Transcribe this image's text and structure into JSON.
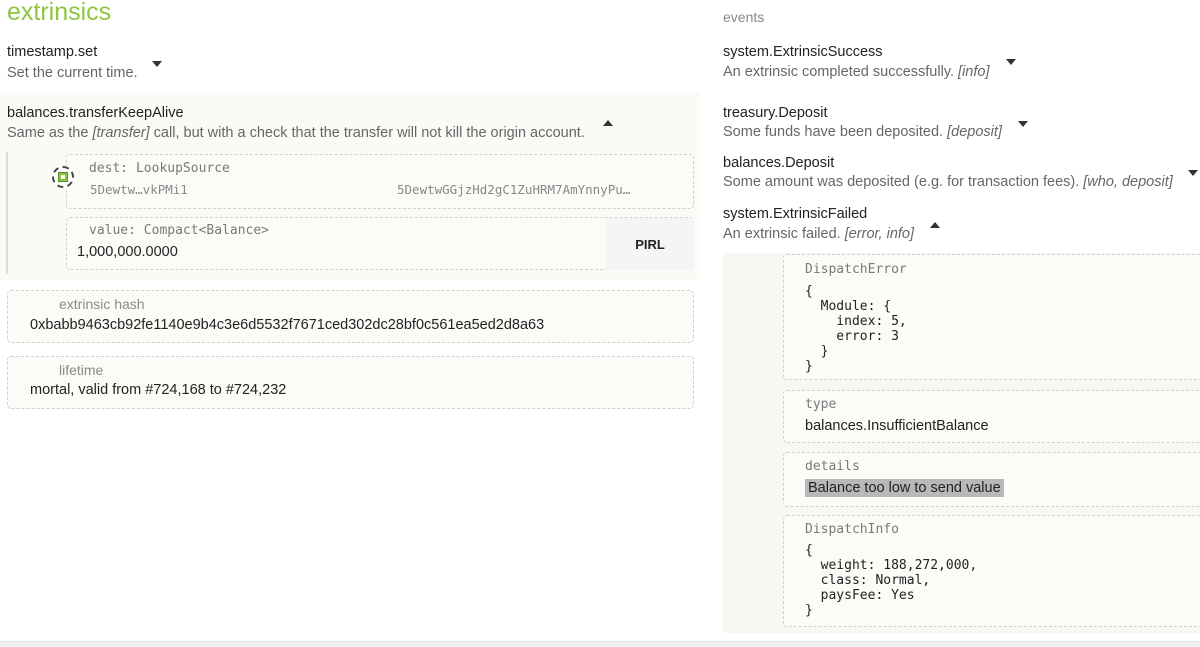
{
  "extrinsics": {
    "title": "extrinsics",
    "calls": [
      {
        "name": "timestamp.set",
        "description": "Set the current time."
      },
      {
        "name": "balances.transferKeepAlive",
        "description_prefix": "Same as the ",
        "description_arg": "[transfer]",
        "description_suffix": " call, but with a check that the transfer will not kill the origin account."
      }
    ],
    "dest": {
      "label": "dest: LookupSource",
      "short_address": "5Dewtw…vkPMi1",
      "full_address": "5DewtwGGjzHd2gC1ZuHRM7AmYnnyPu…"
    },
    "value": {
      "label": "value: Compact<Balance>",
      "amount": "1,000,000.0000",
      "unit": "PIRL"
    },
    "hash": {
      "label": "extrinsic hash",
      "value": "0xbabb9463cb92fe1140e9b4c3e6d5532f7671ced302dc28bf0c561ea5ed2d8a63"
    },
    "lifetime": {
      "label": "lifetime",
      "value": "mortal, valid from #724,168 to #724,232"
    }
  },
  "events": {
    "title": "events",
    "items": [
      {
        "name": "system.ExtrinsicSuccess",
        "description": "An extrinsic completed successfully. ",
        "args": "[info]"
      },
      {
        "name": "treasury.Deposit",
        "description": "Some funds have been deposited. ",
        "args": "[deposit]"
      },
      {
        "name": "balances.Deposit",
        "description": "Some amount was deposited (e.g. for transaction fees). ",
        "args": "[who, deposit]"
      },
      {
        "name": "system.ExtrinsicFailed",
        "description": "An extrinsic failed. ",
        "args": "[error, info]"
      }
    ],
    "failed_details": {
      "dispatch_error_label": "DispatchError",
      "dispatch_error_value": "{\n  Module: {\n    index: 5,\n    error: 3\n  }\n}",
      "type_label": "type",
      "type_value": "balances.InsufficientBalance",
      "details_label": "details",
      "details_value": "Balance too low to send value",
      "dispatch_info_label": "DispatchInfo",
      "dispatch_info_value": "{\n  weight: 188,272,000,\n  class: Normal,\n  paysFee: Yes\n}"
    }
  },
  "icons": {
    "expand": "caret-down-icon",
    "collapse": "caret-up-icon",
    "account": "identicon-icon"
  }
}
